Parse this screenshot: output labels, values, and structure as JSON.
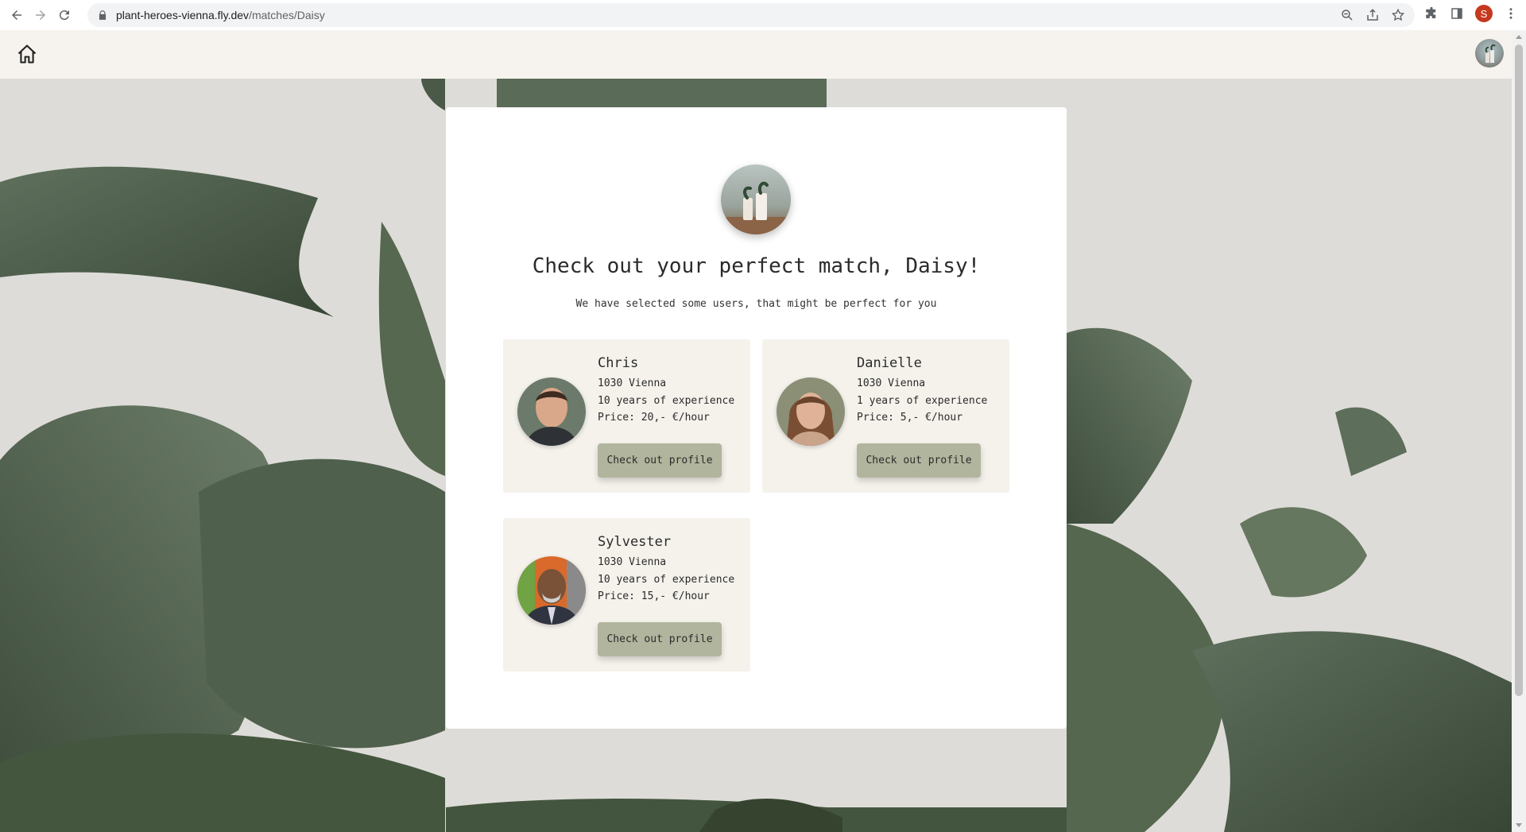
{
  "browser": {
    "url_host": "plant-heroes-vienna.fly.dev",
    "url_path": "/matches/Daisy",
    "profile_initial": "S"
  },
  "header": {
    "home_icon": "home-icon",
    "avatar": "user-avatar"
  },
  "main": {
    "title": "Check out your perfect match, Daisy!",
    "subtitle": "We have selected some users, that might be perfect for you",
    "matches": [
      {
        "name": "Chris",
        "location": "1030 Vienna",
        "experience": "10 years of experience",
        "price": "Price: 20,- €/hour",
        "button_label": "Check out profile"
      },
      {
        "name": "Danielle",
        "location": "1030 Vienna",
        "experience": "1 years of experience",
        "price": "Price: 5,- €/hour",
        "button_label": "Check out profile"
      },
      {
        "name": "Sylvester",
        "location": "1030 Vienna",
        "experience": "10 years of experience",
        "price": "Price: 15,- €/hour",
        "button_label": "Check out profile"
      }
    ]
  },
  "colors": {
    "header_bg": "#f6f3ee",
    "card_bg": "#f5f2ec",
    "button_bg": "#b1b59d",
    "leaf": "#4d5e4c"
  }
}
